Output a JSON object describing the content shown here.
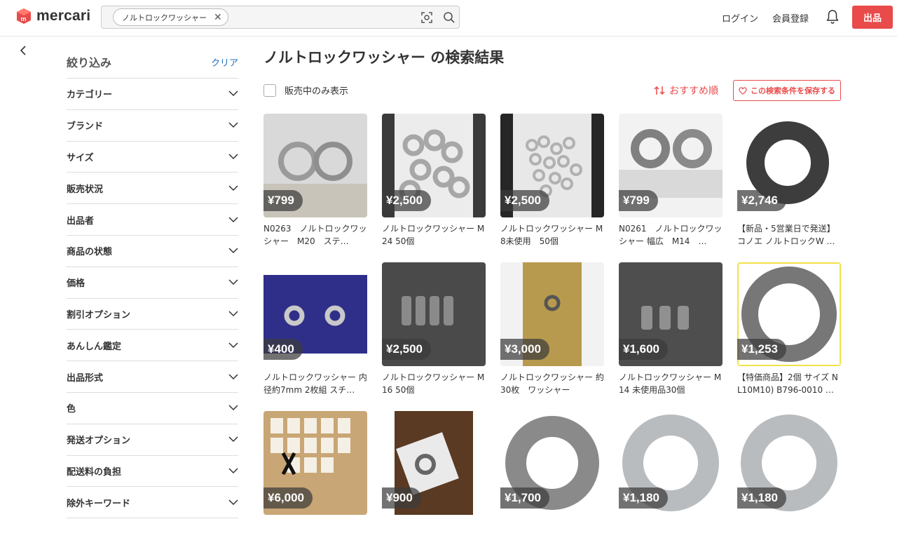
{
  "header": {
    "logo_text": "mercari",
    "search_chip": "ノルトロックワッシャー",
    "login": "ログイン",
    "register": "会員登録",
    "sell": "出品"
  },
  "sidebar": {
    "title": "絞り込み",
    "clear": "クリア",
    "filters": [
      "カテゴリー",
      "ブランド",
      "サイズ",
      "販売状況",
      "出品者",
      "商品の状態",
      "価格",
      "割引オプション",
      "あんしん鑑定",
      "出品形式",
      "色",
      "発送オプション",
      "配送料の負担",
      "除外キーワード"
    ]
  },
  "main": {
    "title": "ノルトロックワッシャー の検索結果",
    "onsale_label": "販売中のみ表示",
    "sort_label": "おすすめ順",
    "save_label": "この検索条件を保存する"
  },
  "items": [
    {
      "price": "¥799",
      "name": "N0263　ノルトロックワッシャー　M20　ステ…"
    },
    {
      "price": "¥2,500",
      "name": "ノルトロックワッシャー M24 50個"
    },
    {
      "price": "¥2,500",
      "name": "ノルトロックワッシャー M8未使用　50個"
    },
    {
      "price": "¥799",
      "name": "N0261　ノルトロックワッシャー 幅広　M14　…"
    },
    {
      "price": "¥2,746",
      "name": "【新品・5営業日で発送】コノエ ノルトロックW …"
    },
    {
      "price": "¥400",
      "name": "ノルトロックワッシャー 内径約7mm 2枚組 スチ…"
    },
    {
      "price": "¥2,500",
      "name": "ノルトロックワッシャー M16 50個"
    },
    {
      "price": "¥3,000",
      "name": "ノルトロックワッシャー 約30枚　ワッシャー"
    },
    {
      "price": "¥1,600",
      "name": "ノルトロックワッシャー M14 未使用品30個"
    },
    {
      "price": "¥1,253",
      "name": "【特価商品】2個 サイズ NL10M10) B796-0010 …"
    },
    {
      "price": "¥6,000",
      "name": ""
    },
    {
      "price": "¥900",
      "name": ""
    },
    {
      "price": "¥1,700",
      "name": ""
    },
    {
      "price": "¥1,180",
      "name": ""
    },
    {
      "price": "¥1,180",
      "name": ""
    }
  ],
  "colors": {
    "accent": "#e94b4b",
    "link": "#1f6fbf"
  }
}
